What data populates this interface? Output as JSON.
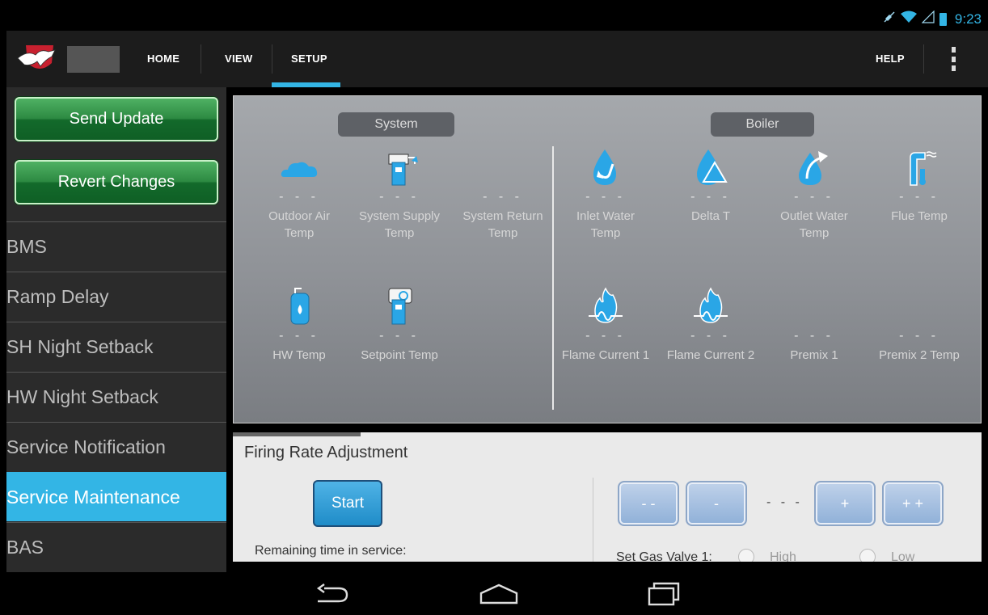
{
  "status_bar": {
    "time": "9:23",
    "icons": [
      "mute-icon",
      "wifi-icon",
      "signal-icon",
      "battery-icon"
    ]
  },
  "action_bar": {
    "tabs": [
      {
        "label": "HOME"
      },
      {
        "label": "VIEW"
      },
      {
        "label": "SETUP",
        "selected": true
      }
    ],
    "help_label": "HELP"
  },
  "sidebar": {
    "send_update": "Send Update",
    "revert_changes": "Revert Changes",
    "items": [
      {
        "label": "BMS"
      },
      {
        "label": "Ramp Delay"
      },
      {
        "label": "SH Night Setback"
      },
      {
        "label": "HW Night Setback"
      },
      {
        "label": "Service Notification"
      },
      {
        "label": "Service Maintenance",
        "active": true
      },
      {
        "label": "BAS"
      }
    ]
  },
  "system": {
    "title": "System",
    "sensors": [
      {
        "label": "Outdoor Air Temp",
        "value": "- - -",
        "icon": "cloud-icon"
      },
      {
        "label": "System Supply Temp",
        "value": "- - -",
        "icon": "supply-pipe-icon"
      },
      {
        "label": "System Return Temp",
        "value": "- - -",
        "icon": ""
      },
      {
        "label": "HW Temp",
        "value": "- - -",
        "icon": "water-heater-icon"
      },
      {
        "label": "Setpoint Temp",
        "value": "- - -",
        "icon": "setpoint-icon"
      }
    ]
  },
  "boiler": {
    "title": "Boiler",
    "sensors": [
      {
        "label": "Inlet Water Temp",
        "value": "- - -",
        "icon": "inlet-drop-icon"
      },
      {
        "label": "Delta T",
        "value": "- - -",
        "icon": "delta-drop-icon"
      },
      {
        "label": "Outlet Water Temp",
        "value": "- - -",
        "icon": "outlet-drop-icon"
      },
      {
        "label": "Flue Temp",
        "value": "- - -",
        "icon": "flue-icon"
      },
      {
        "label": "Flame Current 1",
        "value": "- - -",
        "icon": "flame-icon"
      },
      {
        "label": "Flame Current 2",
        "value": "- - -",
        "icon": "flame-icon"
      },
      {
        "label": "Premix 1",
        "value": "- - -",
        "icon": ""
      },
      {
        "label": "Premix 2 Temp",
        "value": "- - -",
        "icon": ""
      }
    ]
  },
  "firing_rate": {
    "title": "Firing Rate Adjustment",
    "start_label": "Start",
    "remaining_label": "Remaining time in service:",
    "value": "- - -",
    "buttons": [
      "- -",
      "-",
      "+",
      "+ +"
    ],
    "gas_valve_label": "Set Gas Valve 1:",
    "high_label": "High",
    "low_label": "Low"
  },
  "colors": {
    "accent": "#33b5e5",
    "green": "#2d8a42",
    "panel": "#8f9297"
  }
}
